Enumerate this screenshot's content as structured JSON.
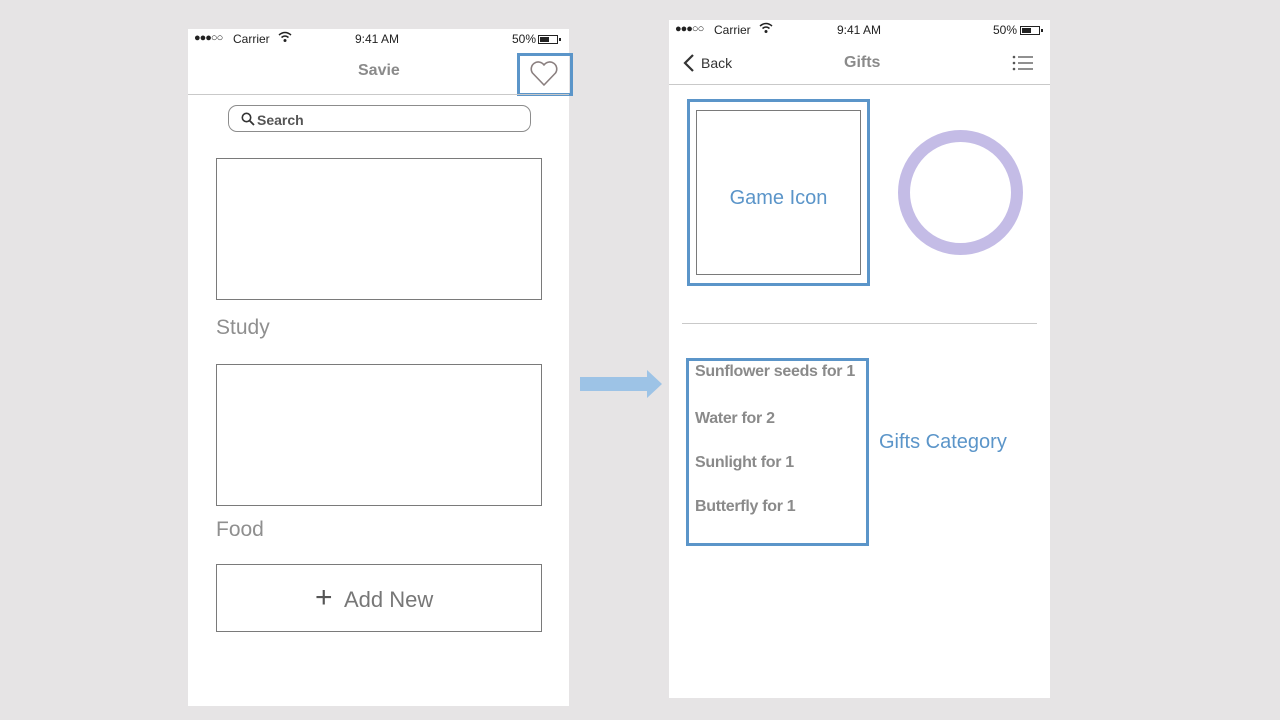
{
  "colors": {
    "highlight": "#5b95c9",
    "ring": "#c4bce6",
    "arrow": "#9dc3e6",
    "background": "#e6e4e5"
  },
  "screen1": {
    "status": {
      "signal": "●●●○○",
      "carrier": "Carrier",
      "time": "9:41 AM",
      "battery": "50%"
    },
    "title": "Savie",
    "favorite_icon": "heart-icon",
    "search": {
      "placeholder": "Search",
      "icon": "search-icon"
    },
    "categories": [
      {
        "label": "Study"
      },
      {
        "label": "Food"
      }
    ],
    "add_new": {
      "icon": "plus-icon",
      "label": "Add New"
    }
  },
  "screen2": {
    "status": {
      "signal": "●●●○○",
      "carrier": "Carrier",
      "time": "9:41 AM",
      "battery": "50%"
    },
    "back_label": "Back",
    "title": "Gifts",
    "menu_icon": "list-icon",
    "game_icon_label": "Game Icon",
    "gifts": [
      "Sunflower seeds for 1",
      "Water for 2",
      "Sunlight for 1",
      "Butterfly for 1"
    ],
    "gifts_category_label": "Gifts Category"
  },
  "flow_arrow": "right-arrow-icon"
}
